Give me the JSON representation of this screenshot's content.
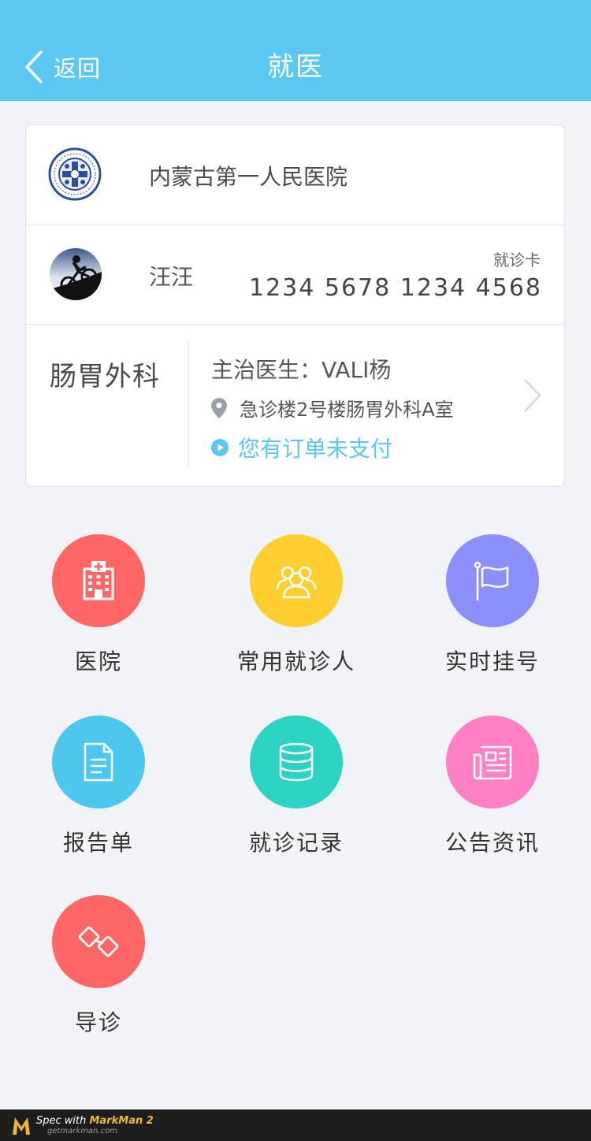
{
  "header": {
    "back_label": "返回",
    "title": "就医",
    "background": "#5bc8f2"
  },
  "hospital": {
    "name": "内蒙古第一人民医院",
    "logo_icon": "hospital-seal-icon"
  },
  "patient": {
    "name": "汪汪",
    "card_type": "就诊卡",
    "card_number": "1234 5678 1234 4568",
    "avatar_icon": "cyclist-avatar"
  },
  "department": {
    "name": "肠胃外科",
    "doctor": "主治医生：VALI杨",
    "location": "急诊楼2号楼肠胃外科A室",
    "unpaid": "您有订单未支付",
    "accent": "#5bc8f2"
  },
  "menu": [
    {
      "label": "医院",
      "icon": "hospital-building-icon",
      "color": "#ff6666"
    },
    {
      "label": "常用就诊人",
      "icon": "people-group-icon",
      "color": "#ffcf2f"
    },
    {
      "label": "实时挂号",
      "icon": "flag-icon",
      "color": "#8b8ffa"
    },
    {
      "label": "报告单",
      "icon": "document-icon",
      "color": "#4dc7ee"
    },
    {
      "label": "就诊记录",
      "icon": "database-icon",
      "color": "#2bd3c2"
    },
    {
      "label": "公告资讯",
      "icon": "newspaper-icon",
      "color": "#ff80c3"
    },
    {
      "label": "导诊",
      "icon": "link-chain-icon",
      "color": "#ff6666"
    }
  ],
  "footer": {
    "spec_prefix": "Spec with ",
    "brand": "MarkMan 2",
    "site": "getmarkman.com"
  }
}
